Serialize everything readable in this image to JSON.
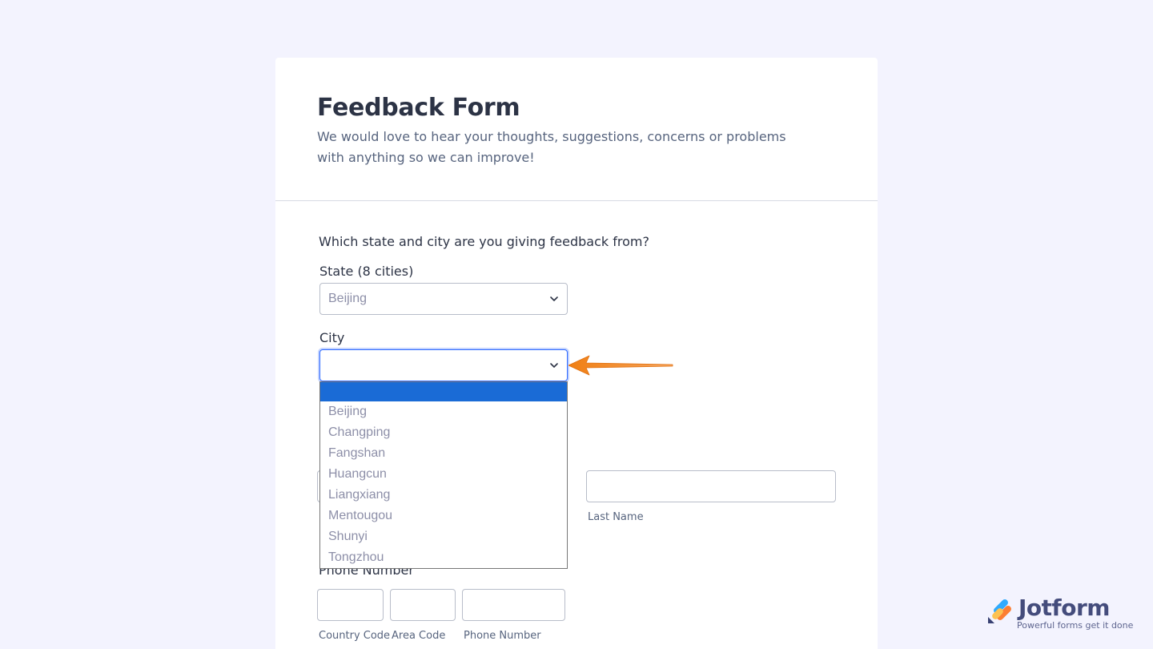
{
  "form": {
    "title": "Feedback Form",
    "subtitle": "We would love to hear your thoughts, suggestions, concerns or problems with anything so we can improve!"
  },
  "location": {
    "question": "Which state and city are you giving feedback from?",
    "state_label": "State (8 cities)",
    "state_value": "Beijing",
    "city_label": "City",
    "city_value": ""
  },
  "city_options": [
    "",
    "Beijing",
    "Changping",
    "Fangshan",
    "Huangcun",
    "Liangxiang",
    "Mentougou",
    "Shunyi",
    "Tongzhou"
  ],
  "name": {
    "last_name_sublabel": "Last Name"
  },
  "phone": {
    "label": "Phone Number",
    "country_code_sublabel": "Country Code",
    "area_code_sublabel": "Area Code",
    "phone_number_sublabel": "Phone Number"
  },
  "branding": {
    "logo_text": "Jotform",
    "tagline": "Powerful forms get it done"
  },
  "colors": {
    "background": "#f3f3fe",
    "accent": "#1a6bd6",
    "arrow": "#f07f13"
  }
}
